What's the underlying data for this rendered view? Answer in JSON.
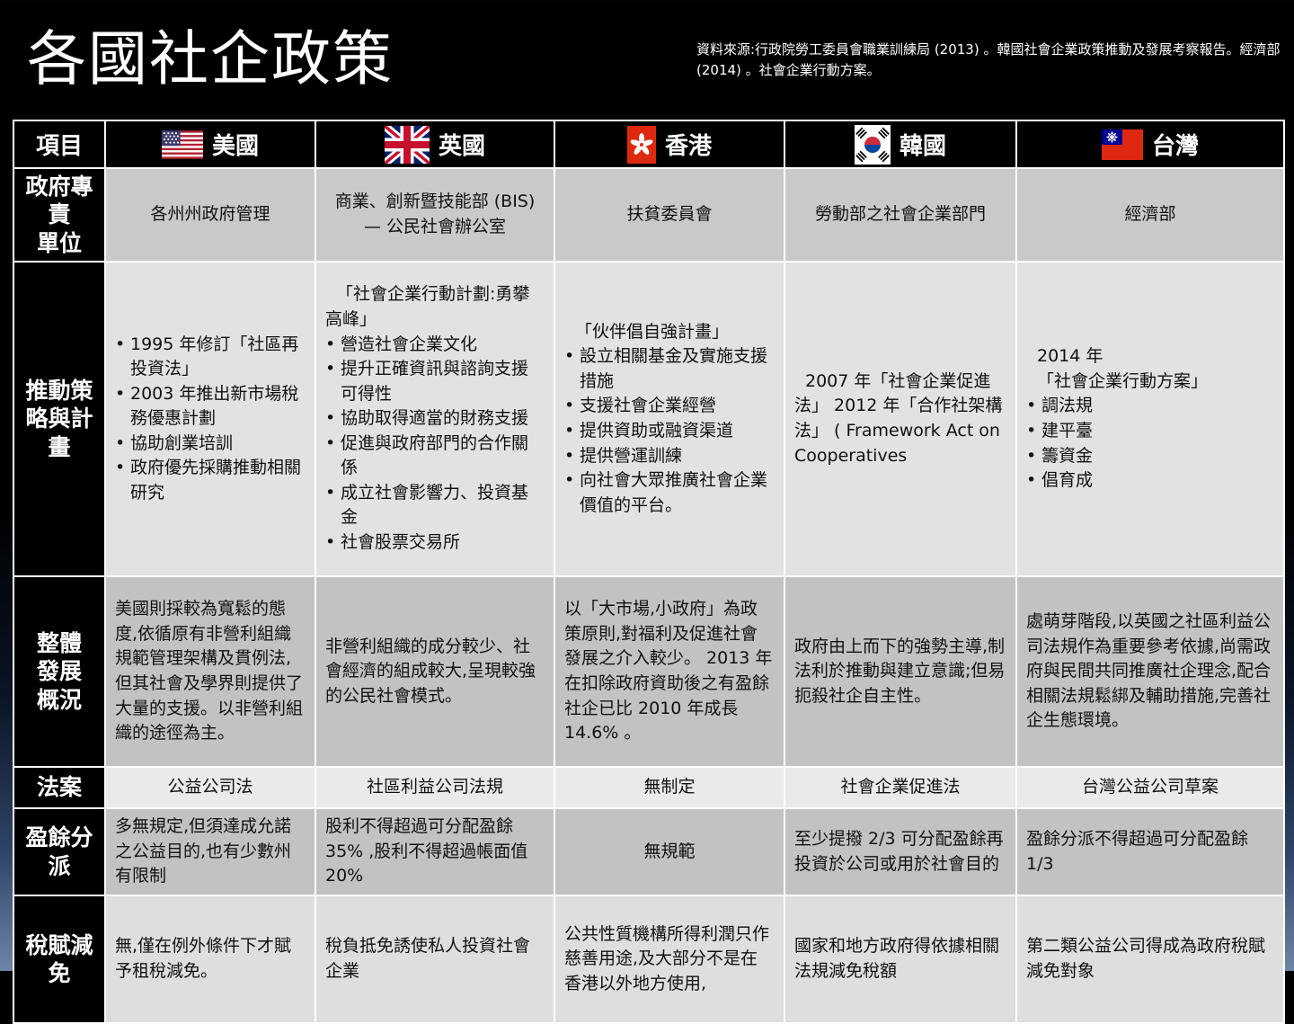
{
  "slide": {
    "title": "各國社企政策",
    "source": "資料來源:行政院勞工委員會職業訓練局 (2013) 。韓國社會企業政策推動及發展考察報告。經濟部 (2014) 。社會企業行動方案。"
  },
  "colors": {
    "header_bg": "#000000",
    "band_dark": "#c2c2c2",
    "band_light": "#e2e2e2",
    "slide_bottom_blue": "#6e85a8",
    "hk_flag_red": "#de2910",
    "tw_flag_blue": "#000095",
    "kr_taegeuk_red": "#cd2e3a",
    "kr_taegeuk_blue": "#0047a0",
    "uk_flag_blue": "#012169",
    "us_flag_red": "#b22234",
    "us_canton_blue": "#3c3b6e"
  },
  "table": {
    "item_header": "項目",
    "columns": [
      {
        "name": "us",
        "label": "美國",
        "flag_icon": "us-flag-icon"
      },
      {
        "name": "uk",
        "label": "英國",
        "flag_icon": "uk-flag-icon"
      },
      {
        "name": "hk",
        "label": "香港",
        "flag_icon": "hk-flag-icon"
      },
      {
        "name": "kr",
        "label": "韓國",
        "flag_icon": "kr-flag-icon"
      },
      {
        "name": "tw",
        "label": "台灣",
        "flag_icon": "tw-flag-icon"
      }
    ],
    "rows": [
      {
        "label": "政府專\n責\n單位",
        "cells": {
          "us": "各州州政府管理",
          "uk": "商業、創新暨技能部 (BIS)\n— 公民社會辦公室",
          "hk": "扶貧委員會",
          "kr": "勞動部之社會企業部門",
          "tw": "經濟部"
        }
      },
      {
        "label": "推動策\n略與計\n畫",
        "blocks": {
          "us": [
            {
              "bullet": true,
              "text": "1995  年修訂「社區再投資法」"
            },
            {
              "bullet": true,
              "text": "2003  年推出新市場稅務優惠計劃"
            },
            {
              "bullet": true,
              "text": "協助創業培訓"
            },
            {
              "bullet": true,
              "text": "政府優先採購推動相關研究"
            }
          ],
          "uk": [
            {
              "bullet": false,
              "text": "「社會企業行動計劃:勇攀高峰」"
            },
            {
              "bullet": true,
              "text": "營造社會企業文化"
            },
            {
              "bullet": true,
              "text": "提升正確資訊與諮詢支援可得性"
            },
            {
              "bullet": true,
              "text": "協助取得適當的財務支援"
            },
            {
              "bullet": true,
              "text": "促進與政府部門的合作關係"
            },
            {
              "bullet": true,
              "text": "成立社會影響力、投資基金"
            },
            {
              "bullet": true,
              "text": "社會股票交易所"
            }
          ],
          "hk": [
            {
              "bullet": false,
              "text": "「伙伴倡自強計畫」"
            },
            {
              "bullet": true,
              "text": "設立相關基金及實施支援措施"
            },
            {
              "bullet": true,
              "text": "支援社會企業經營"
            },
            {
              "bullet": true,
              "text": "提供資助或融資渠道"
            },
            {
              "bullet": true,
              "text": "提供營運訓練"
            },
            {
              "bullet": true,
              "text": "向社會大眾推廣社會企業價值的平台。"
            }
          ],
          "kr": [
            {
              "bullet": false,
              "text": "2007 年「社會企業促進法」 2012 年「合作社架構法」 ( Framework Act on Cooperatives"
            }
          ],
          "tw": [
            {
              "bullet": false,
              "text": "2014 年"
            },
            {
              "bullet": false,
              "text": "「社會企業行動方案」"
            },
            {
              "bullet": true,
              "text": "調法規"
            },
            {
              "bullet": true,
              "text": "建平臺"
            },
            {
              "bullet": true,
              "text": "籌資金"
            },
            {
              "bullet": true,
              "text": "倡育成"
            }
          ]
        }
      },
      {
        "label": "整體\n發展\n概況",
        "cells": {
          "us": "美國則採較為寬鬆的態度,依循原有非營利組織規範管理架構及貫例法,但其社會及學界則提供了大量的支援。以非營利組織的途徑為主。",
          "uk": "非營利組織的成分較少、社會經濟的組成較大,呈現較強的公民社會模式。",
          "hk": "以「大市場,小政府」為政策原則,對福利及促進社會發展之介入較少。 2013 年在扣除政府資助後之有盈餘社企已比 2010 年成長 14.6% 。",
          "kr": "政府由上而下的強勢主導,制法利於推動與建立意識;但易扼殺社企自主性。",
          "tw": "處萌芽階段,以英國之社區利益公司法規作為重要參考依據,尚需政府與民間共同推廣社企理念,配合相關法規鬆綁及輔助措施,完善社企生態環境。"
        }
      },
      {
        "label": "法案",
        "cells": {
          "us": "公益公司法",
          "uk": "社區利益公司法規",
          "hk": "無制定",
          "kr": "社會企業促進法",
          "tw": "台灣公益公司草案"
        }
      },
      {
        "label": "盈餘分\n派",
        "cells": {
          "us": "多無規定,但須達成允諾之公益目的,也有少數州有限制",
          "uk": "股利不得超過可分配盈餘 35% ,股利不得超過帳面值 20%",
          "hk": "無規範",
          "kr": "至少提撥 2/3 可分配盈餘再投資於公司或用於社會目的",
          "tw": "盈餘分派不得超過可分配盈餘 1/3"
        }
      },
      {
        "label": "稅賦減\n免",
        "cells": {
          "us": "無,僅在例外條件下才賦予租稅減免。",
          "uk": "稅負抵免誘使私人投資社會企業",
          "hk": "公共性質機構所得利潤只作慈善用途,及大部分不是在香港以外地方使用,",
          "kr": "國家和地方政府得依據相關法規減免稅額",
          "tw": "第二類公益公司得成為政府稅賦減免對象"
        }
      }
    ]
  }
}
